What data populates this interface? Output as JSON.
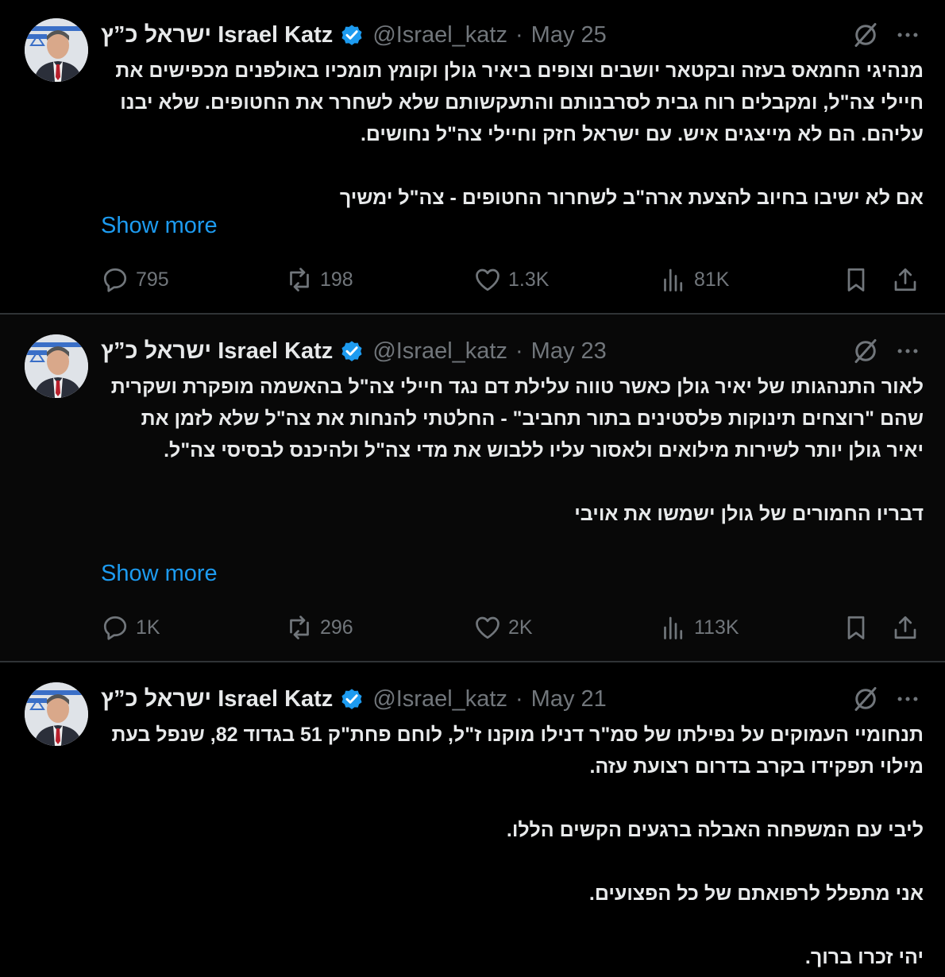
{
  "author": {
    "name": "ישראל כ”ץ Israel Katz",
    "handle": "@Israel_katz"
  },
  "colors": {
    "accent": "#1d9bf0",
    "muted": "#71767b",
    "text": "#e7e9ea",
    "background": "#000000"
  },
  "tweets": [
    {
      "date": "May 25",
      "paragraphs": [
        "מנהיגי החמאס בעזה ובקטאר יושבים וצופים ביאיר גולן וקומץ תומכיו באולפנים מכפישים את חיילי צה\"ל, ומקבלים רוח גבית לסרבנותם והתעקשותם שלא לשחרר את החטופים. שלא יבנו עליהם. הם לא מייצגים איש. עם ישראל חזק וחיילי צה\"ל נחושים.",
        "אם לא ישיבו בחיוב להצעת ארה\"ב לשחרור החטופים - צה\"ל ימשיך"
      ],
      "show_more": "Show more",
      "replies": "795",
      "reposts": "198",
      "likes": "1.3K",
      "views": "81K"
    },
    {
      "date": "May 23",
      "paragraphs": [
        "לאור התנהגותו של יאיר גולן כאשר טווה עלילת דם נגד חיילי צה\"ל בהאשמה מופקרת ושקרית שהם \"רוצחים תינוקות פלסטינים בתור תחביב\" - החלטתי להנחות את צה\"ל שלא לזמן את יאיר גולן יותר לשירות מילואים ולאסור עליו ללבוש את מדי צה\"ל ולהיכנס לבסיסי צה\"ל.",
        "דבריו החמורים של גולן ישמשו את אויבי"
      ],
      "show_more": "Show more",
      "replies": "1K",
      "reposts": "296",
      "likes": "2K",
      "views": "113K"
    },
    {
      "date": "May 21",
      "paragraphs": [
        "תנחומיי העמוקים על נפילתו של סמ\"ר דנילו מוקנו ז\"ל, לוחם פחת\"ק 51 בגדוד 82, שנפל בעת מילוי תפקידו בקרב בדרום רצועת עזה.",
        "ליבי עם המשפחה האבלה ברגעים הקשים הללו.",
        "אני מתפלל לרפואתם של כל הפצועים.",
        "יהי זכרו ברוך."
      ]
    }
  ]
}
